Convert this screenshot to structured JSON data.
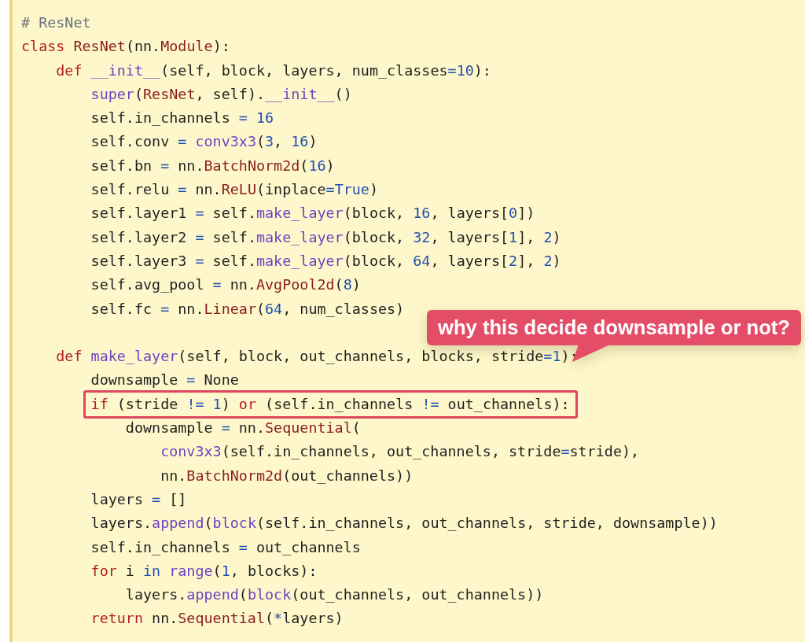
{
  "code": {
    "lines": [
      {
        "tokens": [
          {
            "kind": "comment",
            "text": "# ResNet"
          }
        ]
      },
      {
        "tokens": [
          {
            "kind": "keyword",
            "text": "class"
          },
          {
            "kind": "class",
            "text": " ResNet"
          },
          {
            "kind": "plain",
            "text": "(nn."
          },
          {
            "kind": "class",
            "text": "Module"
          },
          {
            "kind": "plain",
            "text": "):"
          }
        ],
        "children": [
          {
            "tokens": [
              {
                "kind": "keyword",
                "text": "def"
              },
              {
                "kind": "function",
                "text": " __init__"
              },
              {
                "kind": "plain",
                "text": "(self, block, layers, num_classes"
              },
              {
                "kind": "operator",
                "text": "="
              },
              {
                "kind": "number",
                "text": "10"
              },
              {
                "kind": "plain",
                "text": "):"
              }
            ],
            "children": [
              {
                "tokens": [
                  {
                    "kind": "function",
                    "text": "super"
                  },
                  {
                    "kind": "plain",
                    "text": "("
                  },
                  {
                    "kind": "class",
                    "text": "ResNet"
                  },
                  {
                    "kind": "plain",
                    "text": ", self)."
                  },
                  {
                    "kind": "function",
                    "text": "__init__"
                  },
                  {
                    "kind": "plain",
                    "text": "()"
                  }
                ]
              },
              {
                "tokens": [
                  {
                    "kind": "plain",
                    "text": "self.in_channels "
                  },
                  {
                    "kind": "operator",
                    "text": "="
                  },
                  {
                    "kind": "number",
                    "text": " 16"
                  }
                ]
              },
              {
                "tokens": [
                  {
                    "kind": "plain",
                    "text": "self.conv "
                  },
                  {
                    "kind": "operator",
                    "text": "="
                  },
                  {
                    "kind": "function",
                    "text": " conv3x3"
                  },
                  {
                    "kind": "plain",
                    "text": "("
                  },
                  {
                    "kind": "number",
                    "text": "3"
                  },
                  {
                    "kind": "plain",
                    "text": ", "
                  },
                  {
                    "kind": "number",
                    "text": "16"
                  },
                  {
                    "kind": "plain",
                    "text": ")"
                  }
                ]
              },
              {
                "tokens": [
                  {
                    "kind": "plain",
                    "text": "self.bn "
                  },
                  {
                    "kind": "operator",
                    "text": "="
                  },
                  {
                    "kind": "plain",
                    "text": " nn."
                  },
                  {
                    "kind": "class",
                    "text": "BatchNorm2d"
                  },
                  {
                    "kind": "plain",
                    "text": "("
                  },
                  {
                    "kind": "number",
                    "text": "16"
                  },
                  {
                    "kind": "plain",
                    "text": ")"
                  }
                ]
              },
              {
                "tokens": [
                  {
                    "kind": "plain",
                    "text": "self.relu "
                  },
                  {
                    "kind": "operator",
                    "text": "="
                  },
                  {
                    "kind": "plain",
                    "text": " nn."
                  },
                  {
                    "kind": "class",
                    "text": "ReLU"
                  },
                  {
                    "kind": "plain",
                    "text": "(inplace"
                  },
                  {
                    "kind": "operator",
                    "text": "="
                  },
                  {
                    "kind": "number",
                    "text": "True"
                  },
                  {
                    "kind": "plain",
                    "text": ")"
                  }
                ]
              },
              {
                "tokens": [
                  {
                    "kind": "plain",
                    "text": "self.layer1 "
                  },
                  {
                    "kind": "operator",
                    "text": "="
                  },
                  {
                    "kind": "plain",
                    "text": " self."
                  },
                  {
                    "kind": "function",
                    "text": "make_layer"
                  },
                  {
                    "kind": "plain",
                    "text": "(block, "
                  },
                  {
                    "kind": "number",
                    "text": "16"
                  },
                  {
                    "kind": "plain",
                    "text": ", layers["
                  },
                  {
                    "kind": "number",
                    "text": "0"
                  },
                  {
                    "kind": "plain",
                    "text": "])"
                  }
                ]
              },
              {
                "tokens": [
                  {
                    "kind": "plain",
                    "text": "self.layer2 "
                  },
                  {
                    "kind": "operator",
                    "text": "="
                  },
                  {
                    "kind": "plain",
                    "text": " self."
                  },
                  {
                    "kind": "function",
                    "text": "make_layer"
                  },
                  {
                    "kind": "plain",
                    "text": "(block, "
                  },
                  {
                    "kind": "number",
                    "text": "32"
                  },
                  {
                    "kind": "plain",
                    "text": ", layers["
                  },
                  {
                    "kind": "number",
                    "text": "1"
                  },
                  {
                    "kind": "plain",
                    "text": "], "
                  },
                  {
                    "kind": "number",
                    "text": "2"
                  },
                  {
                    "kind": "plain",
                    "text": ")"
                  }
                ]
              },
              {
                "tokens": [
                  {
                    "kind": "plain",
                    "text": "self.layer3 "
                  },
                  {
                    "kind": "operator",
                    "text": "="
                  },
                  {
                    "kind": "plain",
                    "text": " self."
                  },
                  {
                    "kind": "function",
                    "text": "make_layer"
                  },
                  {
                    "kind": "plain",
                    "text": "(block, "
                  },
                  {
                    "kind": "number",
                    "text": "64"
                  },
                  {
                    "kind": "plain",
                    "text": ", layers["
                  },
                  {
                    "kind": "number",
                    "text": "2"
                  },
                  {
                    "kind": "plain",
                    "text": "], "
                  },
                  {
                    "kind": "number",
                    "text": "2"
                  },
                  {
                    "kind": "plain",
                    "text": ")"
                  }
                ]
              },
              {
                "tokens": [
                  {
                    "kind": "plain",
                    "text": "self.avg_pool "
                  },
                  {
                    "kind": "operator",
                    "text": "="
                  },
                  {
                    "kind": "plain",
                    "text": " nn."
                  },
                  {
                    "kind": "class",
                    "text": "AvgPool2d"
                  },
                  {
                    "kind": "plain",
                    "text": "("
                  },
                  {
                    "kind": "number",
                    "text": "8"
                  },
                  {
                    "kind": "plain",
                    "text": ")"
                  }
                ]
              },
              {
                "tokens": [
                  {
                    "kind": "plain",
                    "text": "self.fc "
                  },
                  {
                    "kind": "operator",
                    "text": "="
                  },
                  {
                    "kind": "plain",
                    "text": " nn."
                  },
                  {
                    "kind": "class",
                    "text": "Linear"
                  },
                  {
                    "kind": "plain",
                    "text": "("
                  },
                  {
                    "kind": "number",
                    "text": "64"
                  },
                  {
                    "kind": "plain",
                    "text": ", num_classes)"
                  }
                ]
              }
            ]
          },
          {
            "blank_before": true,
            "tokens": [
              {
                "kind": "keyword",
                "text": "def"
              },
              {
                "kind": "function",
                "text": " make_layer"
              },
              {
                "kind": "plain",
                "text": "(self, block, out_channels, blocks, stride"
              },
              {
                "kind": "operator",
                "text": "="
              },
              {
                "kind": "number",
                "text": "1"
              },
              {
                "kind": "plain",
                "text": "):"
              }
            ],
            "children": [
              {
                "tokens": [
                  {
                    "kind": "plain",
                    "text": "downsample "
                  },
                  {
                    "kind": "operator",
                    "text": "="
                  },
                  {
                    "kind": "plain",
                    "text": " None"
                  }
                ]
              },
              {
                "highlighted": true,
                "tokens": [
                  {
                    "kind": "keyword",
                    "text": "if"
                  },
                  {
                    "kind": "plain",
                    "text": " (stride "
                  },
                  {
                    "kind": "operator",
                    "text": "!="
                  },
                  {
                    "kind": "number",
                    "text": " 1"
                  },
                  {
                    "kind": "plain",
                    "text": ") "
                  },
                  {
                    "kind": "keyword",
                    "text": "or"
                  },
                  {
                    "kind": "plain",
                    "text": " (self.in_channels "
                  },
                  {
                    "kind": "operator",
                    "text": "!="
                  },
                  {
                    "kind": "plain",
                    "text": " out_channels):"
                  }
                ],
                "children": [
                  {
                    "tokens": [
                      {
                        "kind": "plain",
                        "text": "downsample "
                      },
                      {
                        "kind": "operator",
                        "text": "="
                      },
                      {
                        "kind": "plain",
                        "text": " nn."
                      },
                      {
                        "kind": "class",
                        "text": "Sequential"
                      },
                      {
                        "kind": "plain",
                        "text": "("
                      }
                    ],
                    "children": [
                      {
                        "tokens": [
                          {
                            "kind": "function",
                            "text": "conv3x3"
                          },
                          {
                            "kind": "plain",
                            "text": "(self.in_channels, out_channels, stride"
                          },
                          {
                            "kind": "operator",
                            "text": "="
                          },
                          {
                            "kind": "plain",
                            "text": "stride),"
                          }
                        ]
                      },
                      {
                        "tokens": [
                          {
                            "kind": "plain",
                            "text": "nn."
                          },
                          {
                            "kind": "class",
                            "text": "BatchNorm2d"
                          },
                          {
                            "kind": "plain",
                            "text": "(out_channels))"
                          }
                        ]
                      }
                    ]
                  }
                ]
              },
              {
                "tokens": [
                  {
                    "kind": "plain",
                    "text": "layers "
                  },
                  {
                    "kind": "operator",
                    "text": "="
                  },
                  {
                    "kind": "plain",
                    "text": " []"
                  }
                ]
              },
              {
                "tokens": [
                  {
                    "kind": "plain",
                    "text": "layers."
                  },
                  {
                    "kind": "function",
                    "text": "append"
                  },
                  {
                    "kind": "plain",
                    "text": "("
                  },
                  {
                    "kind": "function",
                    "text": "block"
                  },
                  {
                    "kind": "plain",
                    "text": "(self.in_channels, out_channels, stride, downsample))"
                  }
                ]
              },
              {
                "tokens": [
                  {
                    "kind": "plain",
                    "text": "self.in_channels "
                  },
                  {
                    "kind": "operator",
                    "text": "="
                  },
                  {
                    "kind": "plain",
                    "text": " out_channels"
                  }
                ]
              },
              {
                "tokens": [
                  {
                    "kind": "keyword",
                    "text": "for"
                  },
                  {
                    "kind": "plain",
                    "text": " i "
                  },
                  {
                    "kind": "operator",
                    "text": "in"
                  },
                  {
                    "kind": "function",
                    "text": " range"
                  },
                  {
                    "kind": "plain",
                    "text": "("
                  },
                  {
                    "kind": "number",
                    "text": "1"
                  },
                  {
                    "kind": "plain",
                    "text": ", blocks):"
                  }
                ],
                "children": [
                  {
                    "tokens": [
                      {
                        "kind": "plain",
                        "text": "layers."
                      },
                      {
                        "kind": "function",
                        "text": "append"
                      },
                      {
                        "kind": "plain",
                        "text": "("
                      },
                      {
                        "kind": "function",
                        "text": "block"
                      },
                      {
                        "kind": "plain",
                        "text": "(out_channels, out_channels))"
                      }
                    ]
                  }
                ]
              },
              {
                "tokens": [
                  {
                    "kind": "keyword",
                    "text": "return"
                  },
                  {
                    "kind": "plain",
                    "text": " nn."
                  },
                  {
                    "kind": "class",
                    "text": "Sequential"
                  },
                  {
                    "kind": "plain",
                    "text": "("
                  },
                  {
                    "kind": "operator",
                    "text": "*"
                  },
                  {
                    "kind": "plain",
                    "text": "layers)"
                  }
                ]
              }
            ]
          }
        ]
      }
    ]
  },
  "callout": {
    "text": "why this decide downsample or not?"
  }
}
